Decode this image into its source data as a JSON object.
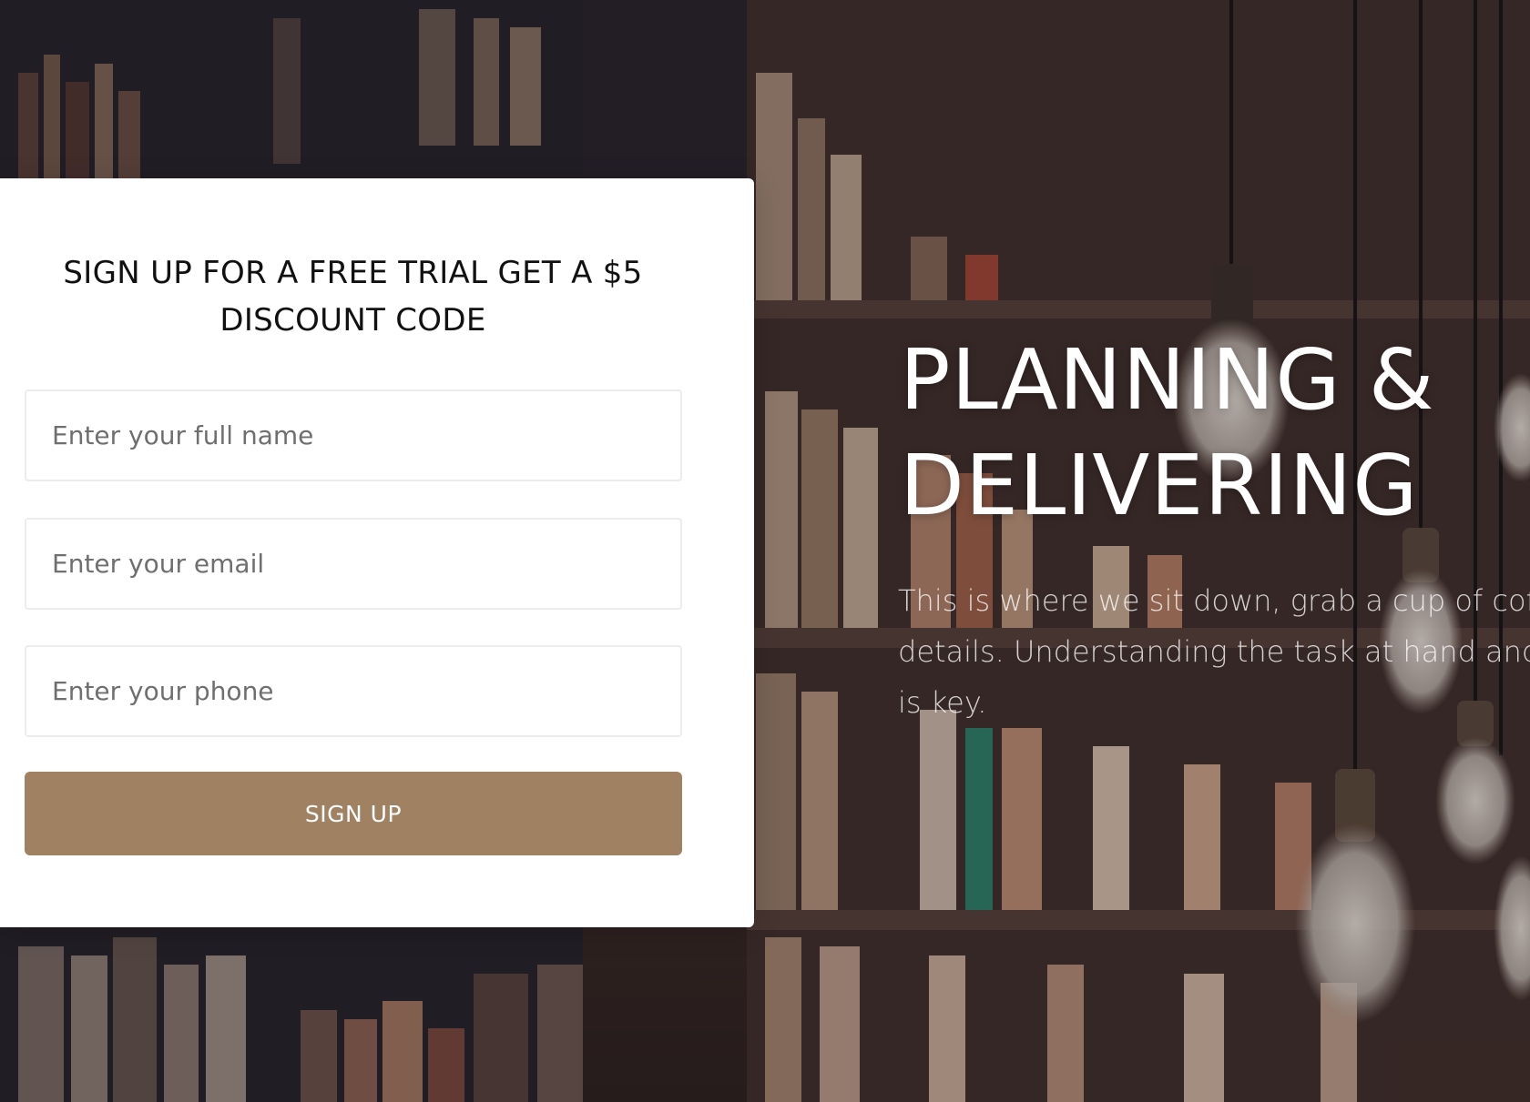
{
  "signup": {
    "title": "SIGN UP FOR A FREE TRIAL GET A $5 DISCOUNT CODE",
    "name_placeholder": "Enter your full name",
    "email_placeholder": "Enter your email",
    "phone_placeholder": "Enter your phone",
    "button_label": "SIGN UP"
  },
  "hero": {
    "heading": "PLANNING & DELIVERING",
    "text_lines": [
      "This is where we sit down, grab a cup of coffe",
      "details. Understanding the task at hand and i",
      "is key."
    ]
  },
  "colors": {
    "accent": "#a08162",
    "card_bg": "#ffffff",
    "title_text": "#111111"
  },
  "icons": {
    "background": "library-bookshelf-photo"
  }
}
